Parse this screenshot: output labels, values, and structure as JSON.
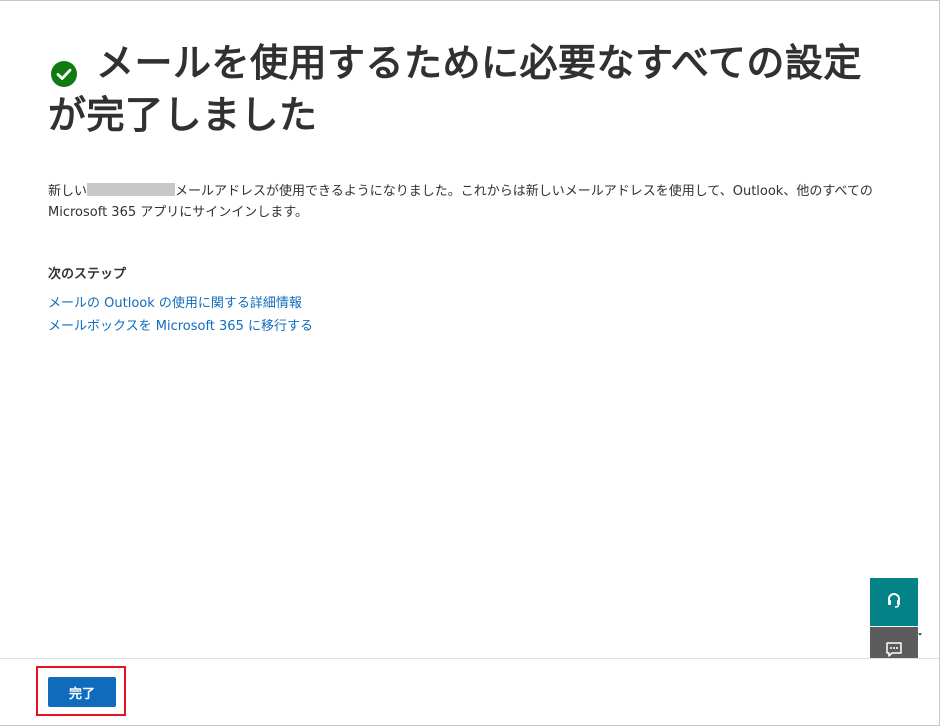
{
  "page": {
    "title": "メールを使用するために必要なすべての設定が完了しました",
    "description_before": "新しい",
    "description_after": "メールアドレスが使用できるようになりました。これからは新しいメールアドレスを使用して、Outlook、他のすべての Microsoft 365 アプリにサインインします。",
    "success_icon": "check-circle-icon",
    "success_color": "#107c10"
  },
  "next_steps": {
    "heading": "次のステップ",
    "links": [
      {
        "label": "メールの Outlook の使用に関する詳細情報"
      },
      {
        "label": "メールボックスを Microsoft 365 に移行する"
      }
    ]
  },
  "footer": {
    "done_label": "完了",
    "button_color": "#0f6cbd"
  },
  "side_buttons": {
    "help_icon": "headset-icon",
    "feedback_icon": "chat-feedback-icon"
  }
}
